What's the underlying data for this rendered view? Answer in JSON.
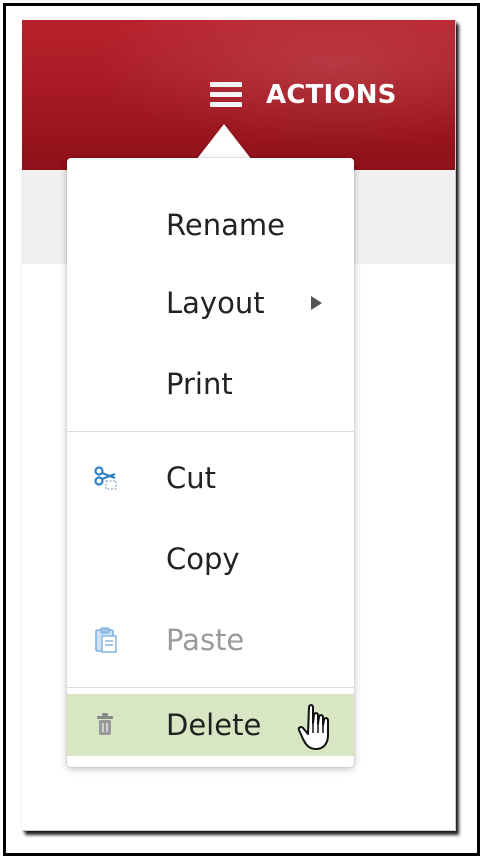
{
  "header": {
    "actions_label": "ACTIONS",
    "menu_icon": "hamburger-icon",
    "bg_color": "#a81a24"
  },
  "menu": {
    "items": [
      {
        "label": "Rename",
        "enabled": true
      },
      {
        "label": "Layout",
        "enabled": true,
        "has_submenu": true,
        "submenu_icon": "triangle-right-icon"
      },
      {
        "label": "Print",
        "enabled": true
      },
      {
        "label": "Cut",
        "enabled": true,
        "icon": "scissors-icon"
      },
      {
        "label": "Copy",
        "enabled": true
      },
      {
        "label": "Paste",
        "enabled": false,
        "icon": "clipboard-icon"
      },
      {
        "label": "Delete",
        "enabled": true,
        "icon": "trash-icon",
        "hovered": true
      }
    ],
    "hover_color": "#d9e6c3"
  },
  "cursor": {
    "type": "hand-pointer-icon"
  }
}
